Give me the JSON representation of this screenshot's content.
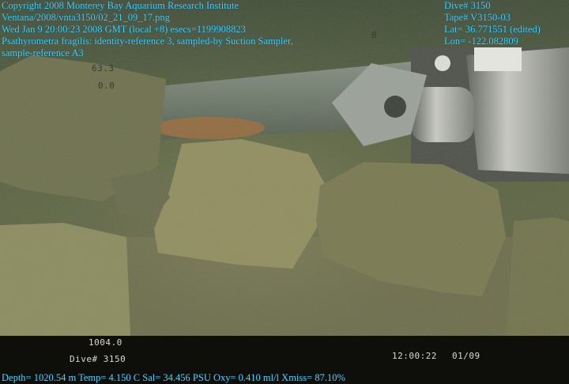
{
  "overlay": {
    "left_lines": [
      "Copyright 2008 Monterey Bay Aquarium Research Institute",
      "Ventana/2008/vnta3150/02_21_09_17.png",
      "Wed Jan  9 20:00:23 2008 GMT (local +8)  esecs=1199908823",
      "Psathyrometra fragilis: identity-reference 3, sampled-by Suction Sampler,",
      "sample-reference A3"
    ],
    "right_lines": [
      "Dive# 3150",
      "Tape# V3150-03",
      "Lat= 36.771551 (edited)",
      "Lon= -122.082809"
    ],
    "bottom_line": "Depth= 1020.54 m  Temp= 4.150 C  Sal= 34.456 PSU  Oxy= 0.410 ml/l  Xmiss= 87.10%",
    "text_color": "#3fd3ff"
  },
  "camera_hud": {
    "heading": "63.3",
    "tilt": "0.0",
    "marker": "8",
    "depth_readout": "1004.0",
    "dive_label": "Dive# 3150",
    "time": "12:00:22",
    "date": "01/09"
  },
  "scene": {
    "description_colors": {
      "water": "#4a5a40",
      "seafloor": "#6d6f4e",
      "rock": "#8a8a62"
    }
  }
}
